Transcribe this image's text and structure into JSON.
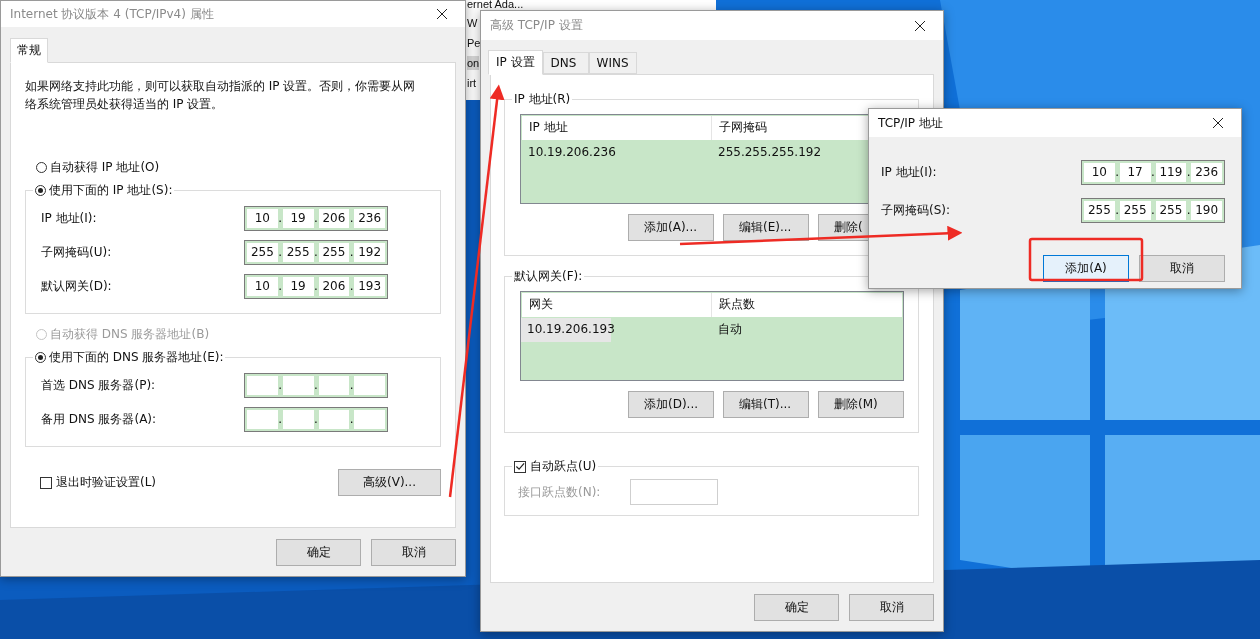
{
  "octet_separator": ".",
  "background_window": {
    "items": [
      {
        "label": "ernet Ada...",
        "selected": false
      },
      {
        "label": "W",
        "selected": false
      },
      {
        "label": "Pe",
        "selected": false
      },
      {
        "label": "on",
        "selected": true
      },
      {
        "label": "irt",
        "selected": false
      }
    ]
  },
  "ipv4_dialog": {
    "title": "Internet 协议版本 4 (TCP/IPv4) 属性",
    "active": false,
    "tabs": [
      {
        "label": "常规",
        "selected": true
      }
    ],
    "description": "如果网络支持此功能，则可以获取自动指派的 IP 设置。否则，你需要从网络系统管理员处获得适当的 IP 设置。",
    "ip_options": [
      {
        "label": "自动获得 IP 地址(O)",
        "selected": false,
        "disabled": false
      },
      {
        "label": "使用下面的 IP 地址(S):",
        "selected": true,
        "disabled": false,
        "fields": [
          {
            "label": "IP 地址(I):",
            "octets": [
              "10",
              "19",
              "206",
              "236"
            ]
          },
          {
            "label": "子网掩码(U):",
            "octets": [
              "255",
              "255",
              "255",
              "192"
            ]
          },
          {
            "label": "默认网关(D):",
            "octets": [
              "10",
              "19",
              "206",
              "193"
            ]
          }
        ]
      }
    ],
    "dns_options": [
      {
        "label": "自动获得 DNS 服务器地址(B)",
        "selected": false,
        "disabled": true
      },
      {
        "label": "使用下面的 DNS 服务器地址(E):",
        "selected": true,
        "disabled": false,
        "fields": [
          {
            "label": "首选 DNS 服务器(P):"
          },
          {
            "label": "备用 DNS 服务器(A):"
          }
        ]
      }
    ],
    "validate_checkbox": {
      "label": "退出时验证设置(L)",
      "checked": false
    },
    "advanced_button": "高级(V)...",
    "buttons": [
      {
        "label": "确定",
        "focused": false
      },
      {
        "label": "取消",
        "focused": false
      }
    ]
  },
  "advanced_dialog": {
    "title": "高级 TCP/IP 设置",
    "active": false,
    "tabs": [
      {
        "label": "IP 设置",
        "selected": true
      },
      {
        "label": "DNS",
        "selected": false
      },
      {
        "label": "WINS",
        "selected": false
      }
    ],
    "groups": [
      {
        "title": "IP 地址(R)",
        "columns": [
          "IP 地址",
          "子网掩码"
        ],
        "rows": [
          {
            "cells": [
              "10.19.206.236",
              "255.255.255.192"
            ],
            "selected": false
          }
        ],
        "buttons": [
          "添加(A)...",
          "编辑(E)...",
          "删除("
        ]
      },
      {
        "title": "默认网关(F):",
        "columns": [
          "网关",
          "跃点数"
        ],
        "rows": [
          {
            "cells": [
              "10.19.206.193",
              "自动"
            ],
            "selected": true
          }
        ],
        "buttons": [
          "添加(D)...",
          "编辑(T)...",
          "删除(M)"
        ]
      }
    ],
    "metric": {
      "label": "自动跃点(U)",
      "checked": true,
      "field_label": "接口跃点数(N):",
      "disabled": true
    },
    "buttons": [
      {
        "label": "确定",
        "focused": false
      },
      {
        "label": "取消",
        "focused": false
      }
    ]
  },
  "address_dialog": {
    "title": "TCP/IP 地址",
    "active": true,
    "fields": [
      {
        "label": "IP 地址(I):",
        "octets": [
          "10",
          "17",
          "119",
          "236"
        ]
      },
      {
        "label": "子网掩码(S):",
        "octets": [
          "255",
          "255",
          "255",
          "190"
        ]
      }
    ],
    "buttons": [
      {
        "label": "添加(A)",
        "focused": true
      },
      {
        "label": "取消",
        "focused": false
      }
    ]
  }
}
